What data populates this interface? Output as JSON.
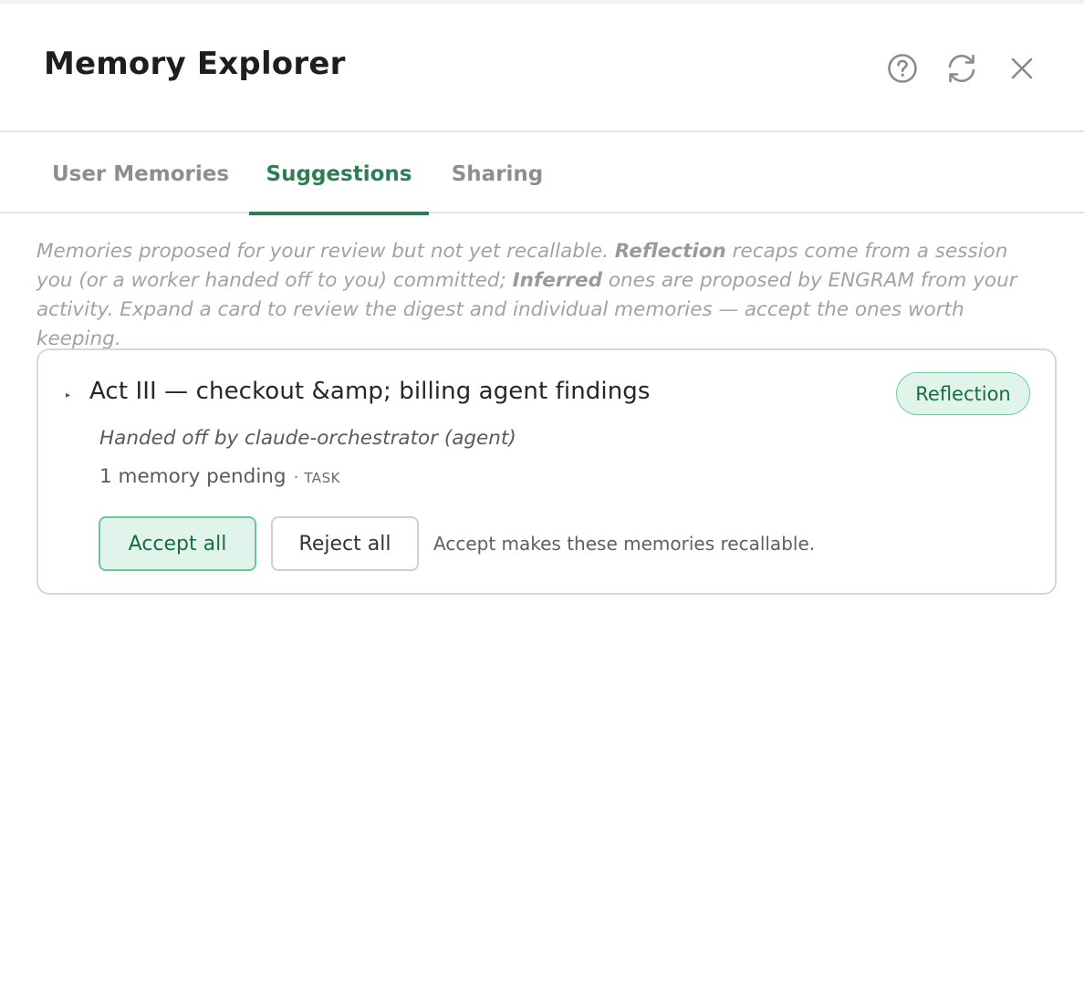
{
  "window": {
    "title": "Memory Explorer"
  },
  "header": {
    "help_icon": "help-circle-icon",
    "refresh_icon": "refresh-icon",
    "close_icon": "close-icon"
  },
  "tabs": [
    {
      "label": "User Memories",
      "active": false
    },
    {
      "label": "Suggestions",
      "active": true
    },
    {
      "label": "Sharing",
      "active": false
    }
  ],
  "intro": {
    "part1": "Memories proposed for your review but not yet recallable. ",
    "bold1": "Reflection",
    "part2": " recaps come from a session you (or a worker handed off to you) committed; ",
    "bold2": "Inferred",
    "part3": " ones are proposed by ENGRAM from your activity. Expand a card to review the digest and individual memories — accept the ones worth keeping."
  },
  "card": {
    "caret": "▸",
    "title": "Act III — checkout &amp; billing agent findings",
    "badge": "Reflection",
    "handoff": "Handed off by claude-orchestrator (agent)",
    "pending": "1 memory pending",
    "separator": "·",
    "kind": "TASK",
    "accept_label": "Accept all",
    "reject_label": "Reject all",
    "accept_note": "Accept makes these memories recallable."
  },
  "colors": {
    "accent": "#2e7d55",
    "badge_bg": "#e1f4eb",
    "badge_border": "#7cc9a2"
  }
}
